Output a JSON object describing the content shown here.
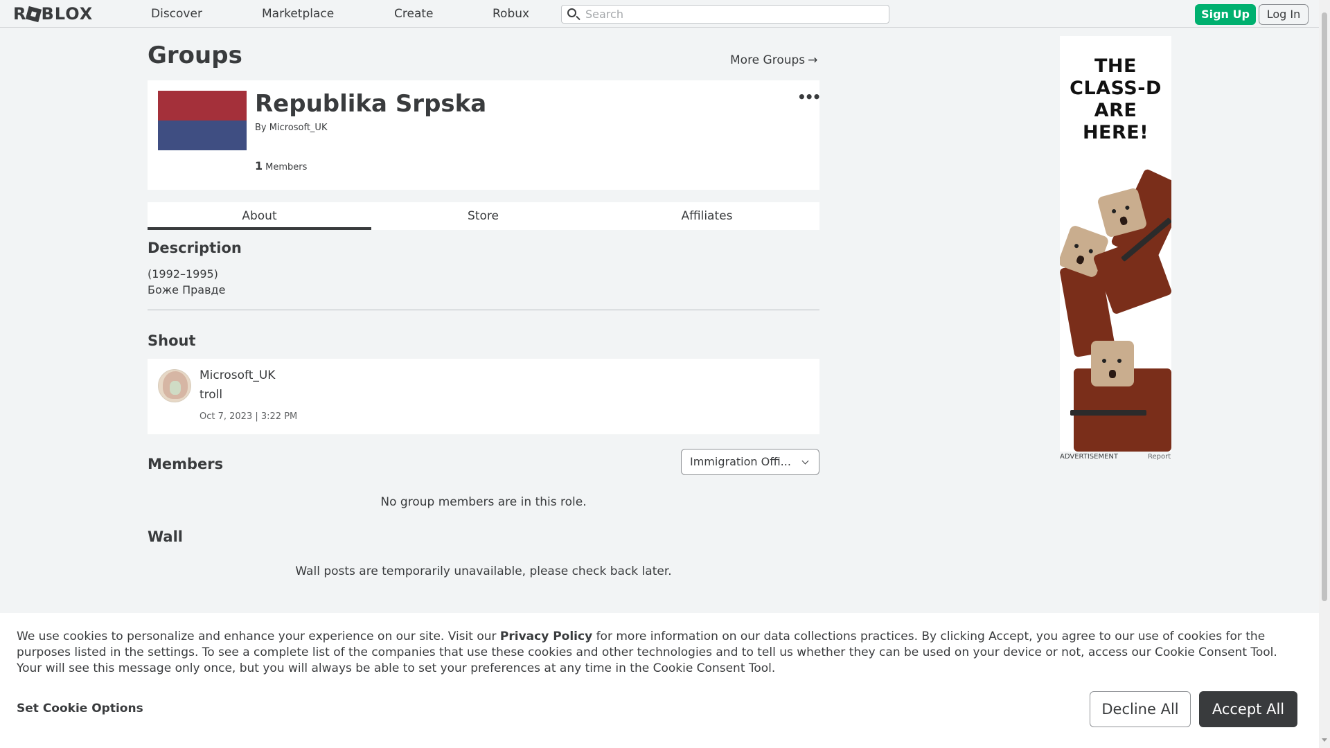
{
  "nav": {
    "logo": "ROBLOX",
    "links": [
      "Discover",
      "Marketplace",
      "Create",
      "Robux"
    ],
    "search_placeholder": "Search",
    "signup_label": "Sign Up",
    "login_label": "Log In"
  },
  "page": {
    "title": "Groups",
    "more_groups": "More Groups"
  },
  "group": {
    "name": "Republika Srpska",
    "by_prefix": "By",
    "owner": "Microsoft_UK",
    "member_count": "1",
    "members_label": "Members",
    "flag_colors": [
      "#a4303a",
      "#3f4e82"
    ]
  },
  "tabs": [
    "About",
    "Store",
    "Affiliates"
  ],
  "description": {
    "title": "Description",
    "lines": [
      "(1992–1995)",
      "Боже Правде"
    ]
  },
  "shout": {
    "title": "Shout",
    "user": "Microsoft_UK",
    "message": "troll",
    "date": "Oct 7, 2023 | 3:22 PM"
  },
  "members": {
    "title": "Members",
    "role_selected": "Immigration Offi...",
    "empty_text": "No group members are in this role."
  },
  "wall": {
    "title": "Wall",
    "empty_text": "Wall posts are temporarily unavailable, please check back later."
  },
  "ad": {
    "headline": [
      "THE",
      "CLASS-D",
      "ARE",
      "HERE!"
    ],
    "label": "ADVERTISEMENT",
    "report": "Report"
  },
  "cookie": {
    "text_before": "We use cookies to personalize and enhance your experience on our site. Visit our ",
    "policy_link": "Privacy Policy",
    "text_after": " for more information on our data collections practices. By clicking Accept, you agree to our use of cookies for the purposes listed in the settings. To see a complete list of the companies that use these cookies and other technologies and to tell us whether they can be used on your device or not, access our Cookie Consent Tool. Your will see this message only once, but you will always be able to set your preferences at any time in the Cookie Consent Tool.",
    "options_label": "Set Cookie Options",
    "decline_label": "Decline All",
    "accept_label": "Accept All"
  },
  "colors": {
    "accent_green": "#00b06f",
    "text_dark": "#393b3d",
    "background": "#f2f4f5"
  }
}
